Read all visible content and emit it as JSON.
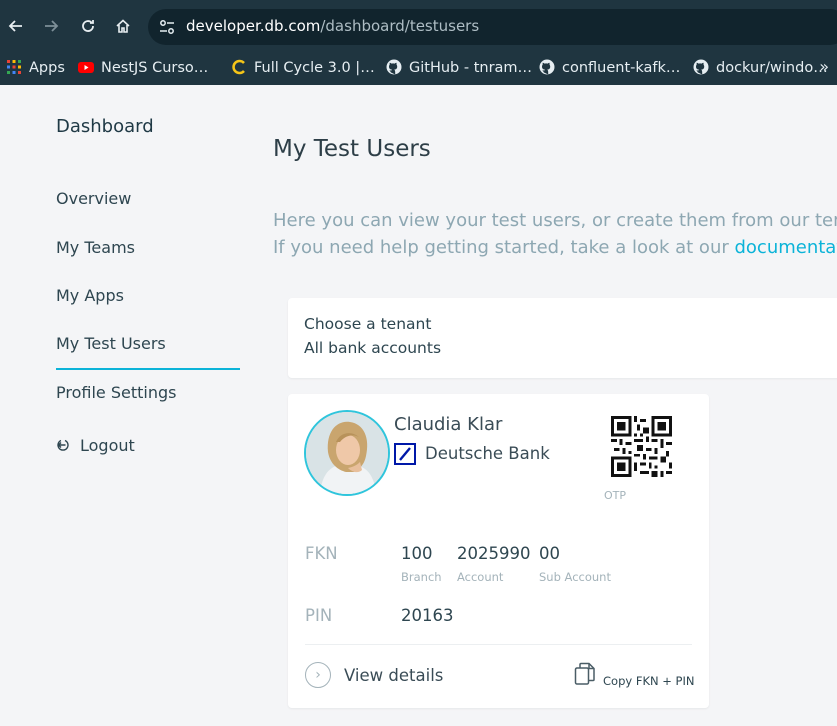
{
  "browser": {
    "back_icon": "arrow-left-icon",
    "forward_icon": "arrow-right-icon",
    "reload_icon": "reload-icon",
    "home_icon": "home-icon",
    "url_host": "developer.db.com",
    "url_path": "/dashboard/testusers",
    "bookmarks": [
      {
        "label": "Apps",
        "icon": "apps-grid-icon"
      },
      {
        "label": "NestJS Curso…",
        "icon": "youtube-icon"
      },
      {
        "label": "Full Cycle 3.0 |…",
        "icon": "fullcycle-icon"
      },
      {
        "label": "GitHub - tnram…",
        "icon": "github-icon"
      },
      {
        "label": "confluent-kafk…",
        "icon": "github-icon"
      },
      {
        "label": "dockur/windo…",
        "icon": "github-icon"
      }
    ],
    "more": "»"
  },
  "sidebar": {
    "title": "Dashboard",
    "items": [
      {
        "label": "Overview"
      },
      {
        "label": "My Teams"
      },
      {
        "label": "My Apps"
      },
      {
        "label": "My Test Users",
        "active": true
      },
      {
        "label": "Profile Settings"
      }
    ],
    "logout_label": "Logout",
    "accent_color": "#0bb3d8"
  },
  "main": {
    "title": "My Test Users",
    "intro_line1": "Here you can view your test users, or create them from our tem",
    "intro_line2_prefix": "If you need help getting started, take a look at our ",
    "intro_link": "documentati"
  },
  "tenant": {
    "label": "Choose a tenant",
    "value": "All bank accounts"
  },
  "user_card": {
    "name": "Claudia Klar",
    "bank": "Deutsche Bank",
    "otp_label": "OTP",
    "fkn_label": "FKN",
    "branch_value": "100",
    "branch_label": "Branch",
    "account_value": "2025990",
    "account_label": "Account",
    "sub_account_value": "00",
    "sub_account_label": "Sub Account",
    "pin_label": "PIN",
    "pin_value": "20163",
    "view_details": "View details",
    "copy_label": "Copy FKN + PIN"
  }
}
